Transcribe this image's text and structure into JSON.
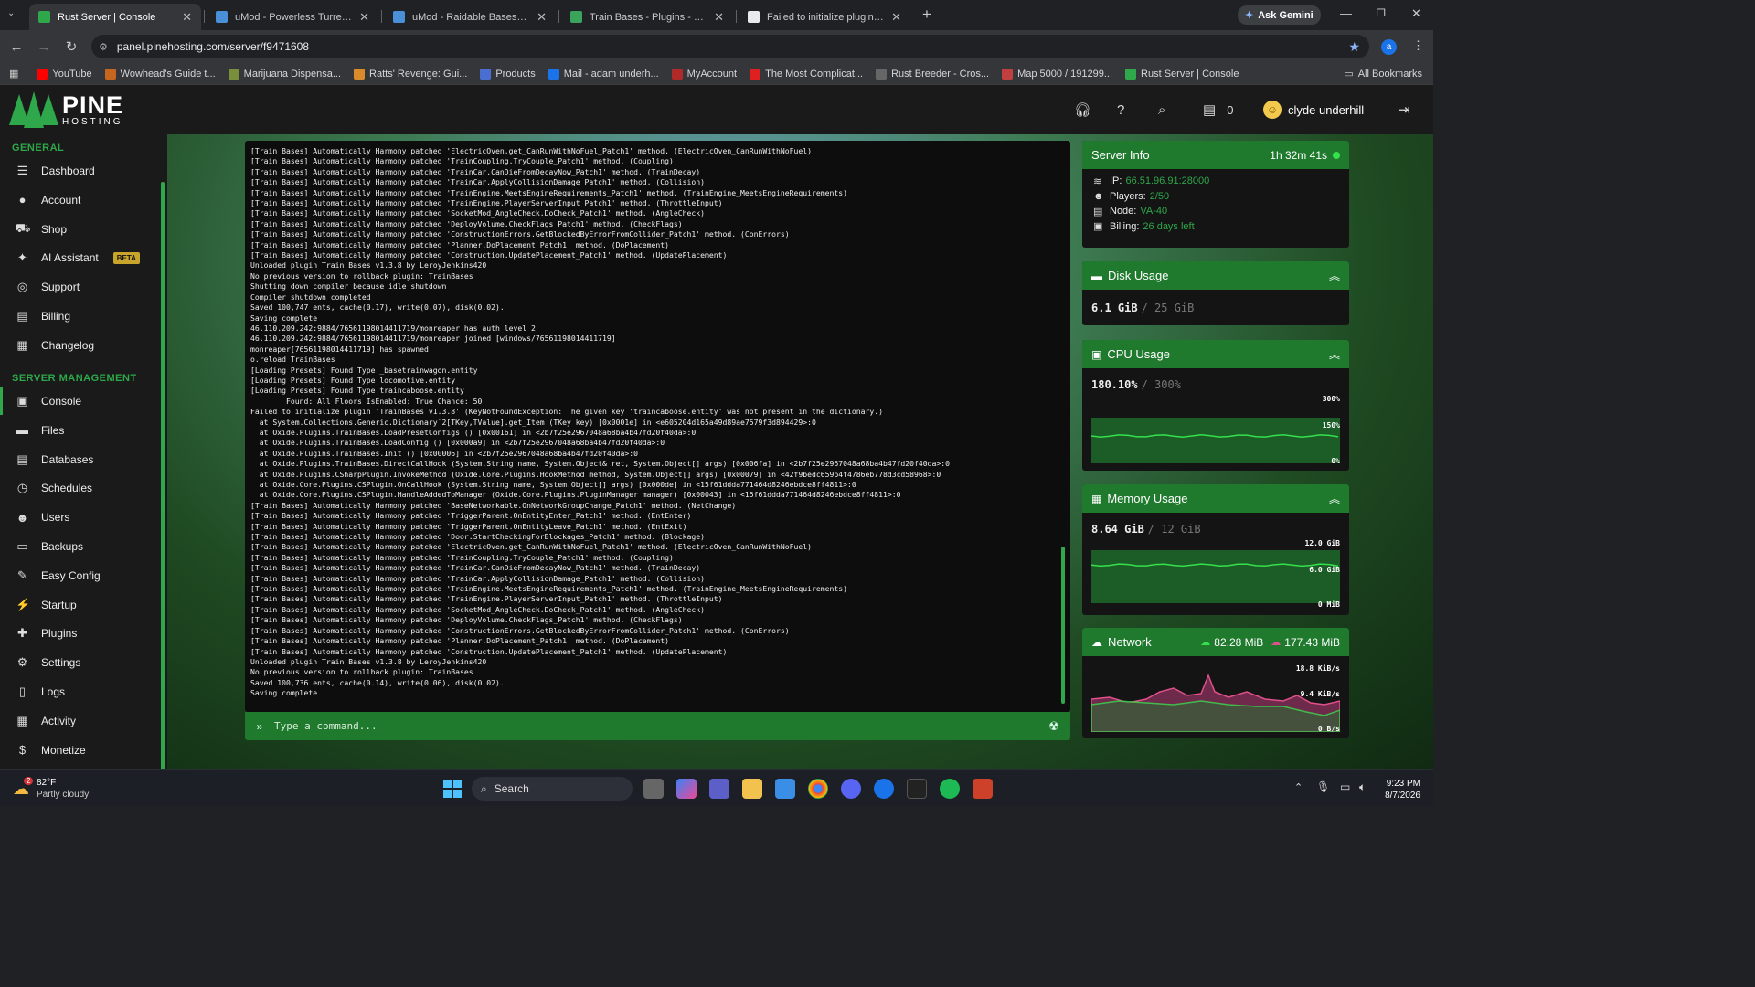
{
  "browser": {
    "tabs": [
      {
        "title": "Rust Server | Console",
        "color": "#2ea84a"
      },
      {
        "title": "uMod - Powerless Turrets by Ar",
        "color": "#4a90d9"
      },
      {
        "title": "uMod - Raidable Bases by nive",
        "color": "#4a90d9"
      },
      {
        "title": "Train Bases - Plugins - Codeflin",
        "color": "#3aa35c"
      },
      {
        "title": "Failed to initialize plugin 'TrainB",
        "color": "#e8eaed"
      }
    ],
    "ask_gemini": "Ask Gemini",
    "url": "panel.pinehosting.com/server/f9471608",
    "profile_initial": "a",
    "bookmarks": [
      "YouTube",
      "Wowhead's Guide t...",
      "Marijuana Dispensa...",
      "Ratts' Revenge: Gui...",
      "Products",
      "Mail - adam underh...",
      "MyAccount",
      "The Most Complicat...",
      "Rust Breeder - Cros...",
      "Map 5000 / 191299...",
      "Rust Server | Console"
    ],
    "all_bookmarks": "All Bookmarks"
  },
  "brand": {
    "name": "PINE",
    "sub": "HOSTING"
  },
  "topbar": {
    "credits": "0",
    "user": "clyde underhill"
  },
  "sidebar": {
    "general_label": "GENERAL",
    "general": [
      {
        "label": "Dashboard",
        "icon": "dashboard-icon",
        "glyph": "☰"
      },
      {
        "label": "Account",
        "icon": "account-icon",
        "glyph": "●"
      },
      {
        "label": "Shop",
        "icon": "cart-icon",
        "glyph": "⛟"
      },
      {
        "label": "AI Assistant",
        "icon": "sparkle-icon",
        "glyph": "✦",
        "badge": "BETA"
      },
      {
        "label": "Support",
        "icon": "lifebuoy-icon",
        "glyph": "◎"
      },
      {
        "label": "Billing",
        "icon": "billing-icon",
        "glyph": "▤"
      },
      {
        "label": "Changelog",
        "icon": "changelog-icon",
        "glyph": "▦"
      }
    ],
    "server_label": "SERVER MANAGEMENT",
    "server": [
      {
        "label": "Console",
        "icon": "terminal-icon",
        "glyph": "▣",
        "active": true
      },
      {
        "label": "Files",
        "icon": "folder-icon",
        "glyph": "▬"
      },
      {
        "label": "Databases",
        "icon": "database-icon",
        "glyph": "▤"
      },
      {
        "label": "Schedules",
        "icon": "clock-icon",
        "glyph": "◷"
      },
      {
        "label": "Users",
        "icon": "users-icon",
        "glyph": "☻"
      },
      {
        "label": "Backups",
        "icon": "archive-icon",
        "glyph": "▭"
      },
      {
        "label": "Easy Config",
        "icon": "wrench-icon",
        "glyph": "✎"
      },
      {
        "label": "Startup",
        "icon": "bolt-icon",
        "glyph": "⚡"
      },
      {
        "label": "Plugins",
        "icon": "puzzle-icon",
        "glyph": "✚"
      },
      {
        "label": "Settings",
        "icon": "gear-icon",
        "glyph": "⚙"
      },
      {
        "label": "Logs",
        "icon": "file-icon",
        "glyph": "▯"
      },
      {
        "label": "Activity",
        "icon": "activity-icon",
        "glyph": "▦"
      },
      {
        "label": "Monetize",
        "icon": "dollar-icon",
        "glyph": "$"
      }
    ]
  },
  "console": {
    "lines": [
      "[Train Bases] Automatically Harmony patched 'ElectricOven.get_CanRunWithNoFuel_Patch1' method. (ElectricOven_CanRunWithNoFuel)",
      "[Train Bases] Automatically Harmony patched 'TrainCoupling.TryCouple_Patch1' method. (Coupling)",
      "[Train Bases] Automatically Harmony patched 'TrainCar.CanDieFromDecayNow_Patch1' method. (TrainDecay)",
      "[Train Bases] Automatically Harmony patched 'TrainCar.ApplyCollisionDamage_Patch1' method. (Collision)",
      "[Train Bases] Automatically Harmony patched 'TrainEngine.MeetsEngineRequirements_Patch1' method. (TrainEngine_MeetsEngineRequirements)",
      "[Train Bases] Automatically Harmony patched 'TrainEngine.PlayerServerInput_Patch1' method. (ThrottleInput)",
      "[Train Bases] Automatically Harmony patched 'SocketMod_AngleCheck.DoCheck_Patch1' method. (AngleCheck)",
      "[Train Bases] Automatically Harmony patched 'DeployVolume.CheckFlags_Patch1' method. (CheckFlags)",
      "[Train Bases] Automatically Harmony patched 'ConstructionErrors.GetBlockedByErrorFromCollider_Patch1' method. (ConErrors)",
      "[Train Bases] Automatically Harmony patched 'Planner.DoPlacement_Patch1' method. (DoPlacement)",
      "[Train Bases] Automatically Harmony patched 'Construction.UpdatePlacement_Patch1' method. (UpdatePlacement)",
      "Unloaded plugin Train Bases v1.3.8 by LeroyJenkins420",
      "No previous version to rollback plugin: TrainBases",
      "Shutting down compiler because idle shutdown",
      "Compiler shutdown completed",
      "Saved 100,747 ents, cache(0.17), write(0.07), disk(0.02).",
      "Saving complete",
      "46.110.209.242:9884/76561198014411719/monreaper has auth level 2",
      "46.110.209.242:9884/76561198014411719/monreaper joined [windows/76561198014411719]",
      "monreaper[76561198014411719] has spawned",
      "o.reload TrainBases",
      "[Loading Presets] Found Type _basetrainwagon.entity",
      "[Loading Presets] Found Type locomotive.entity",
      "[Loading Presets] Found Type traincaboose.entity",
      "        Found: All Floors IsEnabled: True Chance: 50",
      "Failed to initialize plugin 'TrainBases v1.3.8' (KeyNotFoundException: The given key 'traincaboose.entity' was not present in the dictionary.)",
      "  at System.Collections.Generic.Dictionary`2[TKey,TValue].get_Item (TKey key) [0x0001e] in <e605204d165a49d89ae7579f3d894429>:0",
      "  at Oxide.Plugins.TrainBases.LoadPresetConfigs () [0x00161] in <2b7f25e2967048a68ba4b47fd20f40da>:0",
      "  at Oxide.Plugins.TrainBases.LoadConfig () [0x000a9] in <2b7f25e2967048a68ba4b47fd20f40da>:0",
      "  at Oxide.Plugins.TrainBases.Init () [0x00006] in <2b7f25e2967048a68ba4b47fd20f40da>:0",
      "  at Oxide.Plugins.TrainBases.DirectCallHook (System.String name, System.Object& ret, System.Object[] args) [0x006fa] in <2b7f25e2967048a68ba4b47fd20f40da>:0",
      "  at Oxide.Plugins.CSharpPlugin.InvokeMethod (Oxide.Core.Plugins.HookMethod method, System.Object[] args) [0x00079] in <42f9bedc659b4f4786eb778d3cd58968>:0",
      "  at Oxide.Core.Plugins.CSPlugin.OnCallHook (System.String name, System.Object[] args) [0x000de] in <15f61ddda771464d8246ebdce8ff4811>:0",
      "  at Oxide.Core.Plugins.CSPlugin.HandleAddedToManager (Oxide.Core.Plugins.PluginManager manager) [0x00043] in <15f61ddda771464d8246ebdce8ff4811>:0",
      "[Train Bases] Automatically Harmony patched 'BaseNetworkable.OnNetworkGroupChange_Patch1' method. (NetChange)",
      "[Train Bases] Automatically Harmony patched 'TriggerParent.OnEntityEnter_Patch1' method. (EntEnter)",
      "[Train Bases] Automatically Harmony patched 'TriggerParent.OnEntityLeave_Patch1' method. (EntExit)",
      "[Train Bases] Automatically Harmony patched 'Door.StartCheckingForBlockages_Patch1' method. (Blockage)",
      "[Train Bases] Automatically Harmony patched 'ElectricOven.get_CanRunWithNoFuel_Patch1' method. (ElectricOven_CanRunWithNoFuel)",
      "[Train Bases] Automatically Harmony patched 'TrainCoupling.TryCouple_Patch1' method. (Coupling)",
      "[Train Bases] Automatically Harmony patched 'TrainCar.CanDieFromDecayNow_Patch1' method. (TrainDecay)",
      "[Train Bases] Automatically Harmony patched 'TrainCar.ApplyCollisionDamage_Patch1' method. (Collision)",
      "[Train Bases] Automatically Harmony patched 'TrainEngine.MeetsEngineRequirements_Patch1' method. (TrainEngine_MeetsEngineRequirements)",
      "[Train Bases] Automatically Harmony patched 'TrainEngine.PlayerServerInput_Patch1' method. (ThrottleInput)",
      "[Train Bases] Automatically Harmony patched 'SocketMod_AngleCheck.DoCheck_Patch1' method. (AngleCheck)",
      "[Train Bases] Automatically Harmony patched 'DeployVolume.CheckFlags_Patch1' method. (CheckFlags)",
      "[Train Bases] Automatically Harmony patched 'ConstructionErrors.GetBlockedByErrorFromCollider_Patch1' method. (ConErrors)",
      "[Train Bases] Automatically Harmony patched 'Planner.DoPlacement_Patch1' method. (DoPlacement)",
      "[Train Bases] Automatically Harmony patched 'Construction.UpdatePlacement_Patch1' method. (UpdatePlacement)",
      "Unloaded plugin Train Bases v1.3.8 by LeroyJenkins420",
      "No previous version to rollback plugin: TrainBases",
      "Saved 100,736 ents, cache(0.14), write(0.06), disk(0.02).",
      "Saving complete"
    ],
    "placeholder": "Type a command..."
  },
  "server_info": {
    "title": "Server Info",
    "uptime": "1h 32m 41s",
    "ip_label": "IP:",
    "ip": "66.51.96.91:28000",
    "players_label": "Players:",
    "players": "2/50",
    "node_label": "Node:",
    "node": "VA-40",
    "billing_label": "Billing:",
    "billing": "26 days left"
  },
  "disk": {
    "title": "Disk Usage",
    "used": "6.1 GiB",
    "total": "/ 25 GiB"
  },
  "cpu": {
    "title": "CPU Usage",
    "used": "180.10%",
    "total": "/ 300%",
    "ticks": [
      "300%",
      "150%",
      "0%"
    ],
    "level": 0.6
  },
  "memory": {
    "title": "Memory Usage",
    "used": "8.64 GiB",
    "total": "/ 12 GiB",
    "ticks": [
      "12.0 GiB",
      "6.0 GiB",
      "0 MiB"
    ],
    "level": 0.72
  },
  "network": {
    "title": "Network",
    "in": "82.28 MiB",
    "out": "177.43 MiB",
    "ticks": [
      "18.8 KiB/s",
      "9.4 KiB/s",
      "0 B/s"
    ]
  },
  "taskbar": {
    "temp": "82°F",
    "weather": "Partly cloudy",
    "search": "Search",
    "time": "9:23 PM",
    "date": "8/7/2026",
    "weather_badge": "2"
  },
  "colors": {
    "accent": "#2ea84a",
    "header": "#1f7a2e"
  }
}
